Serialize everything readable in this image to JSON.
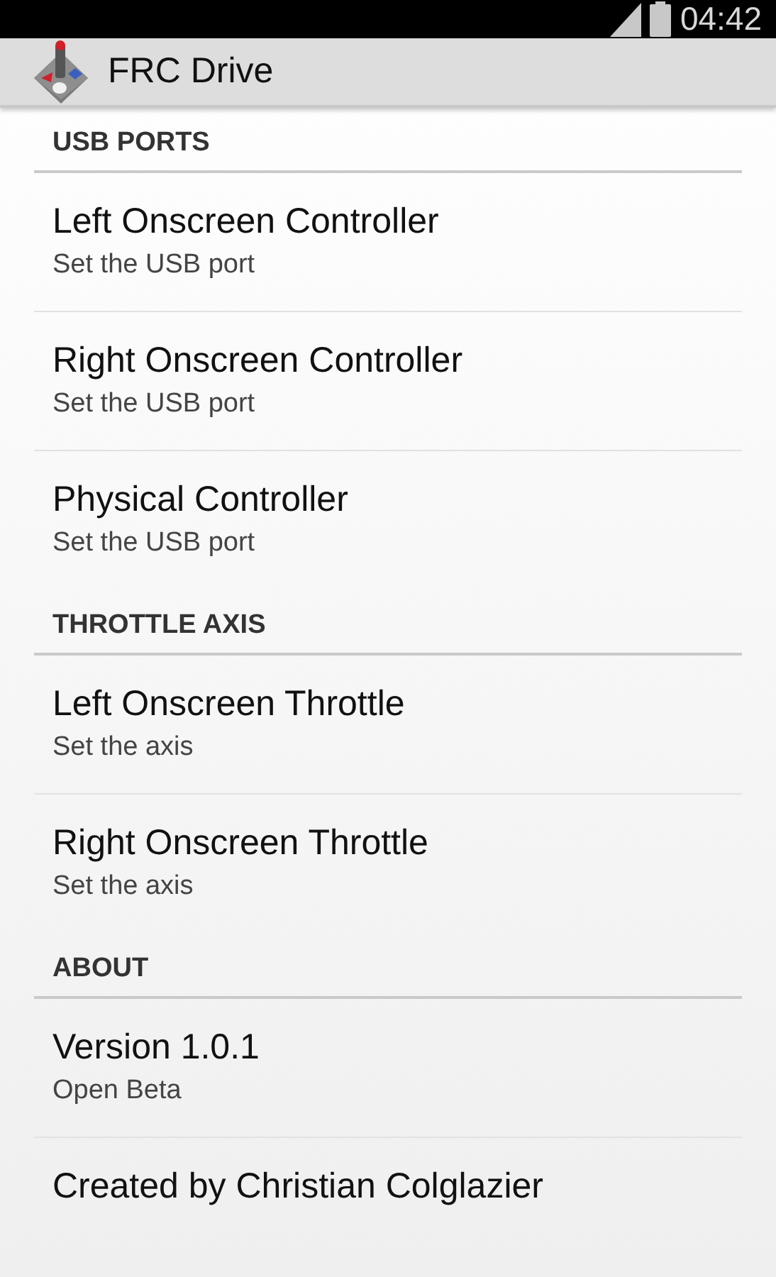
{
  "status_bar": {
    "time": "04:42"
  },
  "app_bar": {
    "title": "FRC Drive"
  },
  "sections": [
    {
      "title": "USB PORTS",
      "items": [
        {
          "title": "Left Onscreen Controller",
          "summary": "Set the USB port"
        },
        {
          "title": "Right Onscreen Controller",
          "summary": "Set the USB port"
        },
        {
          "title": "Physical Controller",
          "summary": "Set the USB port"
        }
      ]
    },
    {
      "title": "THROTTLE AXIS",
      "items": [
        {
          "title": "Left Onscreen Throttle",
          "summary": "Set the axis"
        },
        {
          "title": "Right Onscreen Throttle",
          "summary": "Set the axis"
        }
      ]
    },
    {
      "title": "ABOUT",
      "items": [
        {
          "title": "Version 1.0.1",
          "summary": "Open Beta"
        },
        {
          "title": "Created by Christian Colglazier"
        }
      ]
    }
  ]
}
